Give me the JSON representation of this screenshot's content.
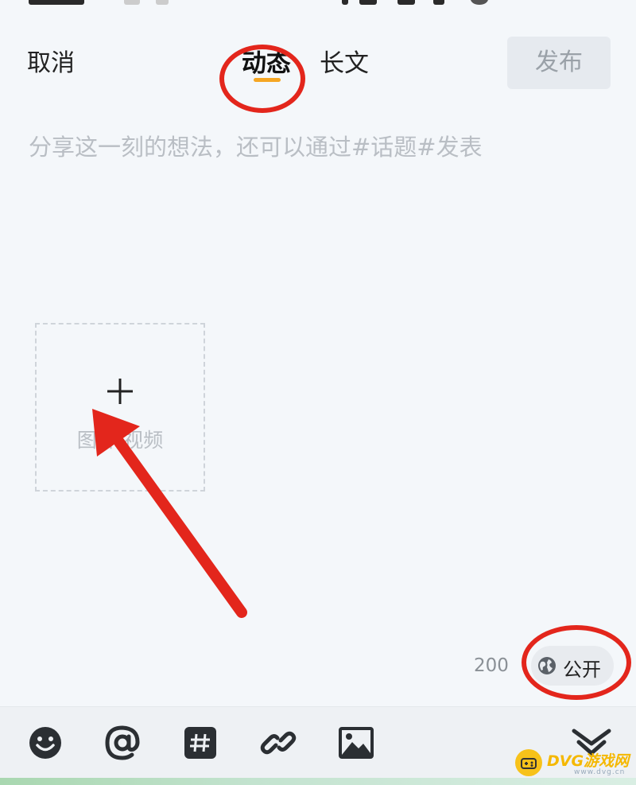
{
  "header": {
    "cancel_label": "取消",
    "tabs": [
      {
        "label": "动态",
        "active": true
      },
      {
        "label": "长文",
        "active": false
      }
    ],
    "publish_label": "发布"
  },
  "composer": {
    "placeholder": "分享这一刻的想法，还可以通过#话题#发表",
    "value": ""
  },
  "media": {
    "add_label": "图片/视频",
    "add_icon": "plus-icon"
  },
  "footer": {
    "char_count": "200",
    "visibility_label": "公开",
    "visibility_icon": "globe-icon"
  },
  "toolbar": {
    "items": [
      {
        "name": "emoji-icon"
      },
      {
        "name": "at-icon"
      },
      {
        "name": "topic-hash-icon"
      },
      {
        "name": "link-icon"
      },
      {
        "name": "image-icon"
      },
      {
        "name": "collapse-chevron-icon"
      }
    ]
  },
  "watermark": {
    "text": "DVG游戏网",
    "sub": "www.dvg.cn"
  },
  "colors": {
    "accent_underline": "#f5a623",
    "annotation_red": "#e3261c",
    "background": "#f4f7fa",
    "publish_disabled_bg": "#e6eaef"
  }
}
